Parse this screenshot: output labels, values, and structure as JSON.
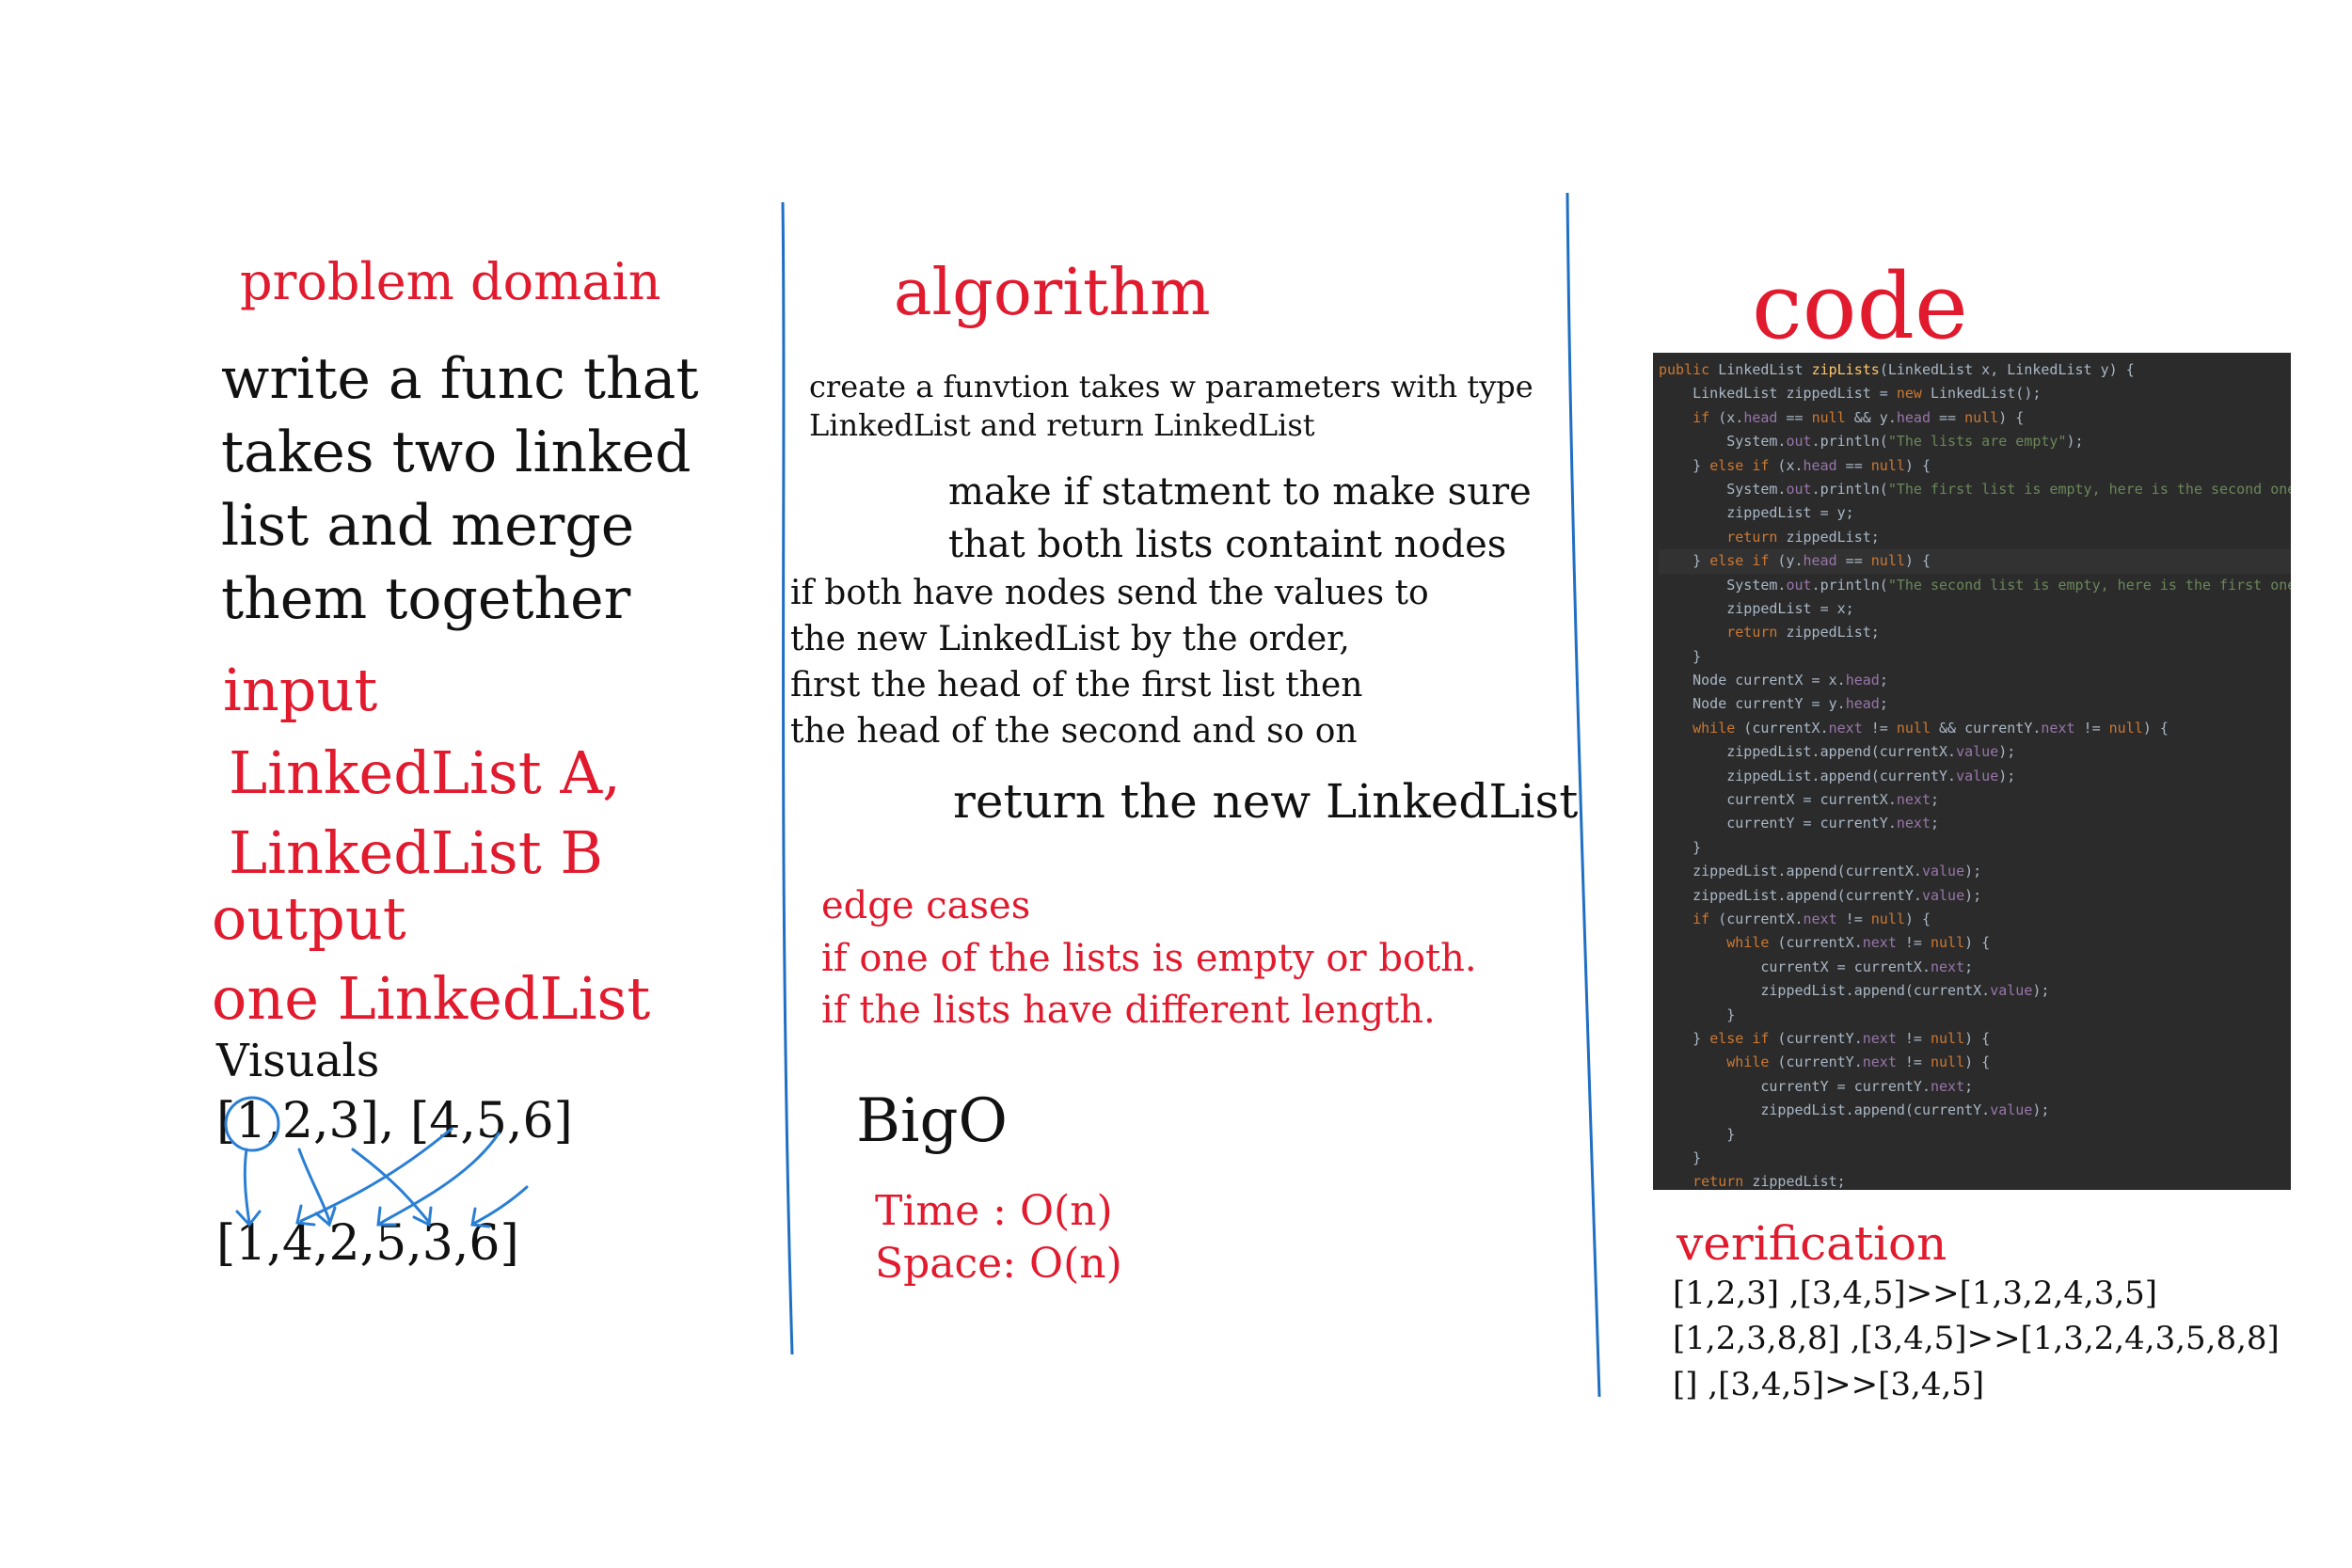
{
  "problem_domain": {
    "heading": "problem domain",
    "description_lines": [
      "write a func that",
      "takes two linked",
      "list and merge",
      "them together"
    ]
  },
  "input": {
    "heading": "input",
    "lines": [
      "LinkedList A,",
      "LinkedList B"
    ]
  },
  "output": {
    "heading": "output",
    "value": "one LinkedList"
  },
  "visuals": {
    "heading": "Visuals",
    "input_lists": "[1,2,3], [4,5,6]",
    "result": "[1,4,2,5,3,6]"
  },
  "algorithm": {
    "heading": "algorithm",
    "step1_lines": [
      "create a funvtion takes w parameters with type",
      "LinkedList and return LinkedList"
    ],
    "step2_lines": [
      "make if statment to make sure",
      "that both lists containt nodes"
    ],
    "step3_lines": [
      "if both have nodes send the values to",
      "the new LinkedList by the order,",
      "first the head of the first list then",
      "the head of the second and so on"
    ],
    "step4": "return the new LinkedList"
  },
  "edge_cases": {
    "heading": "edge cases",
    "lines": [
      "if one of the lists is empty or both.",
      "if the lists have different length."
    ]
  },
  "big_o": {
    "heading": "BigO",
    "time": "Time : O(n)",
    "space": "Space: O(n)"
  },
  "code": {
    "heading": "code",
    "lines": [
      "public LinkedList zipLists(LinkedList x, LinkedList y) {",
      "    LinkedList zippedList = new LinkedList();",
      "    if (x.head == null && y.head == null) {",
      "        System.out.println(\"The lists are empty\");",
      "    } else if (x.head == null) {",
      "        System.out.println(\"The first list is empty, here is the second one\");",
      "        zippedList = y;",
      "        return zippedList;",
      "    } else if (y.head == null) {",
      "        System.out.println(\"The second list is empty, here is the first one\");",
      "        zippedList = x;",
      "        return zippedList;",
      "    }",
      "    Node currentX = x.head;",
      "    Node currentY = y.head;",
      "    while (currentX.next != null && currentY.next != null) {",
      "        zippedList.append(currentX.value);",
      "        zippedList.append(currentY.value);",
      "        currentX = currentX.next;",
      "        currentY = currentY.next;",
      "    }",
      "    zippedList.append(currentX.value);",
      "    zippedList.append(currentY.value);",
      "    if (currentX.next != null) {",
      "        while (currentX.next != null) {",
      "            currentX = currentX.next;",
      "            zippedList.append(currentX.value);",
      "        }",
      "    } else if (currentY.next != null) {",
      "        while (currentY.next != null) {",
      "            currentY = currentY.next;",
      "            zippedList.append(currentY.value);",
      "        }",
      "    }",
      "    return zippedList;"
    ]
  },
  "verification": {
    "heading": "verification",
    "lines": [
      "[1,2,3] ,[3,4,5]>>[1,3,2,4,3,5]",
      "[1,2,3,8,8] ,[3,4,5]>>[1,3,2,4,3,5,8,8]",
      "[] ,[3,4,5]>>[3,4,5]"
    ]
  },
  "colors": {
    "heading_red": "#e11a2e",
    "divider_blue": "#1f6fc5",
    "arrow_blue": "#2a7fd4",
    "code_bg": "#2b2b2b"
  }
}
